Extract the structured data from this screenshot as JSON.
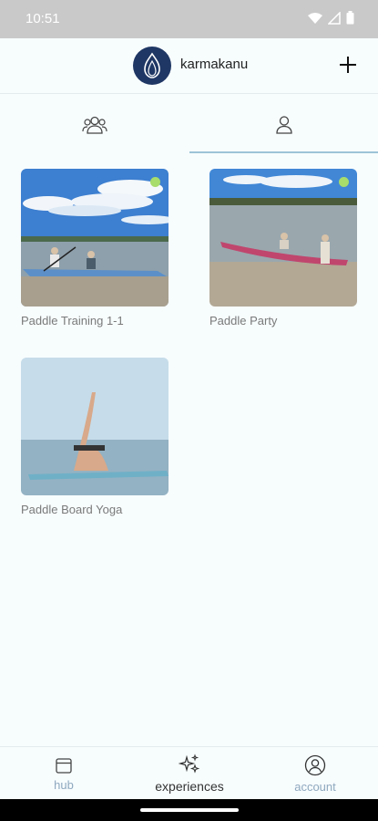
{
  "status_bar": {
    "time": "10:51"
  },
  "header": {
    "brand_name": "karmakanu",
    "logo_icon": "flame-logo",
    "add_icon": "plus-icon"
  },
  "tabs": [
    {
      "icon": "group-icon",
      "selected": false
    },
    {
      "icon": "person-icon",
      "selected": true
    }
  ],
  "experiences": [
    {
      "title": "Paddle Training 1-1",
      "status_color": "#a8dc6b"
    },
    {
      "title": "Paddle Party",
      "status_color": "#a8dc6b"
    },
    {
      "title": "Paddle Board Yoga"
    }
  ],
  "bottom_nav": {
    "hub": "hub",
    "experiences": "experiences",
    "account": "account"
  },
  "colors": {
    "accent": "#9cc3d6",
    "brand": "#1f3764",
    "nav_inactive": "#8fa9bf",
    "nav_active": "#333333"
  }
}
